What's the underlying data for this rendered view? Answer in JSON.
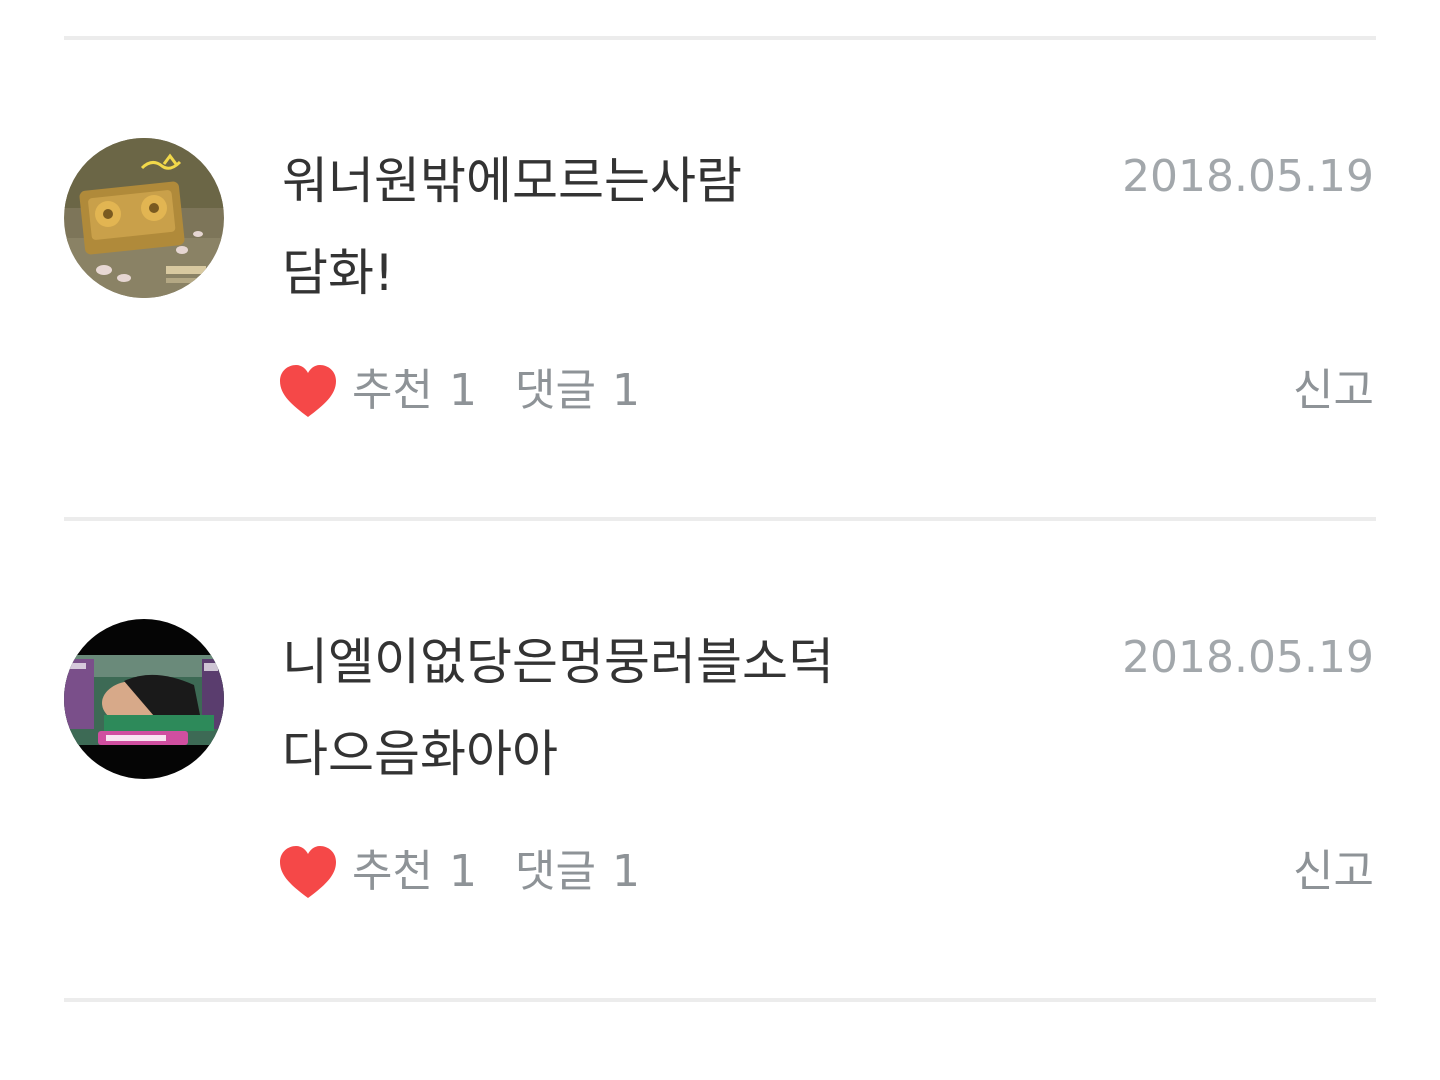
{
  "comments": [
    {
      "author": "워너원밖에모르는사람",
      "date": "2018.05.19",
      "text": "담화!",
      "like_label": "추천",
      "like_count": "1",
      "reply_label": "댓글",
      "reply_count": "1",
      "report_label": "신고",
      "avatar_icon": "cassette-tape-album-avatar"
    },
    {
      "author": "니엘이없당은멍뭉러블소덕",
      "date": "2018.05.19",
      "text": "다으음화아아",
      "like_label": "추천",
      "like_count": "1",
      "reply_label": "댓글",
      "reply_count": "1",
      "report_label": "신고",
      "avatar_icon": "video-still-avatar"
    }
  ],
  "colors": {
    "heart": "#f54848",
    "muted_text": "#8e9397",
    "date_text": "#a2a7ab",
    "divider": "#ececec"
  }
}
